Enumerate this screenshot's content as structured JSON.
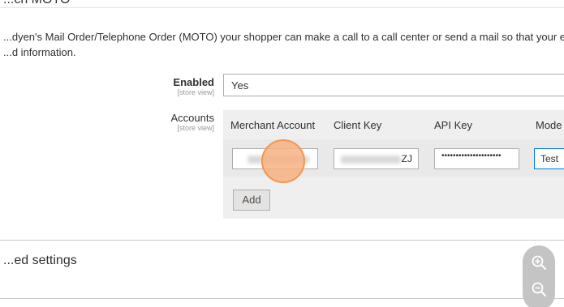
{
  "section": {
    "title": "...ch MOTO",
    "description_line1": "...dyen's Mail Order/Telephone Order (MOTO) your shopper can make a call to a call center or send a mail so that your employee can pl",
    "description_line2": "...d information."
  },
  "enabled": {
    "label": "Enabled",
    "scope": "[store view]",
    "value": "Yes"
  },
  "accounts": {
    "label": "Accounts",
    "scope": "[store view]",
    "columns": [
      "Merchant Account",
      "Client Key",
      "API Key",
      "Mode"
    ],
    "row": {
      "merchant_account": "",
      "client_key_suffix": "ZJ",
      "api_key_mask": "•••••••••••••••••••••",
      "mode": "Test"
    },
    "add_label": "Add"
  },
  "advanced": {
    "title": "...ed settings"
  },
  "zoom": {
    "in_icon": "zoom-in-icon",
    "out_icon": "zoom-out-icon"
  },
  "colors": {
    "click_indicator": "#f39653",
    "focus_border": "#007bdb"
  }
}
